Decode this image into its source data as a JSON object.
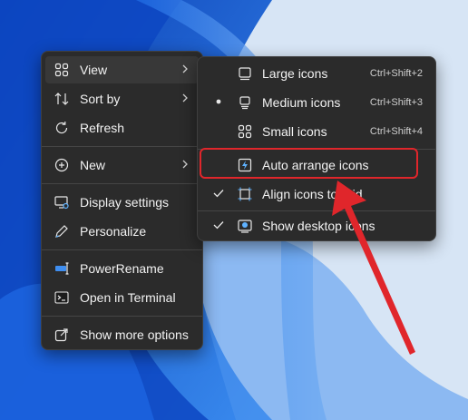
{
  "main_menu": {
    "items": [
      {
        "label": "View",
        "icon": "view-grid-icon",
        "has_submenu": true
      },
      {
        "label": "Sort by",
        "icon": "sort-icon",
        "has_submenu": true
      },
      {
        "label": "Refresh",
        "icon": "refresh-icon",
        "has_submenu": false
      },
      {
        "label": "New",
        "icon": "new-plus-icon",
        "has_submenu": true
      },
      {
        "label": "Display settings",
        "icon": "display-settings-icon",
        "has_submenu": false
      },
      {
        "label": "Personalize",
        "icon": "pen-icon",
        "has_submenu": false
      },
      {
        "label": "PowerRename",
        "icon": "power-rename-icon",
        "has_submenu": false
      },
      {
        "label": "Open in Terminal",
        "icon": "terminal-icon",
        "has_submenu": false
      },
      {
        "label": "Show more options",
        "icon": "show-more-icon",
        "has_submenu": false
      }
    ]
  },
  "view_submenu": {
    "items": [
      {
        "label": "Large icons",
        "shortcut": "Ctrl+Shift+2",
        "icon": "large-icons-icon",
        "mark": "none"
      },
      {
        "label": "Medium icons",
        "shortcut": "Ctrl+Shift+3",
        "icon": "medium-icons-icon",
        "mark": "bullet"
      },
      {
        "label": "Small icons",
        "shortcut": "Ctrl+Shift+4",
        "icon": "small-icons-icon",
        "mark": "none"
      },
      {
        "label": "Auto arrange icons",
        "shortcut": "",
        "icon": "auto-arrange-icon",
        "mark": "none"
      },
      {
        "label": "Align icons to grid",
        "shortcut": "",
        "icon": "align-grid-icon",
        "mark": "check"
      },
      {
        "label": "Show desktop icons",
        "shortcut": "",
        "icon": "show-desktop-icon",
        "mark": "check"
      }
    ]
  },
  "colors": {
    "menu_bg": "#2b2b2b",
    "highlight": "#e0262b",
    "wallpaper_blue": "#1a5fd6"
  }
}
